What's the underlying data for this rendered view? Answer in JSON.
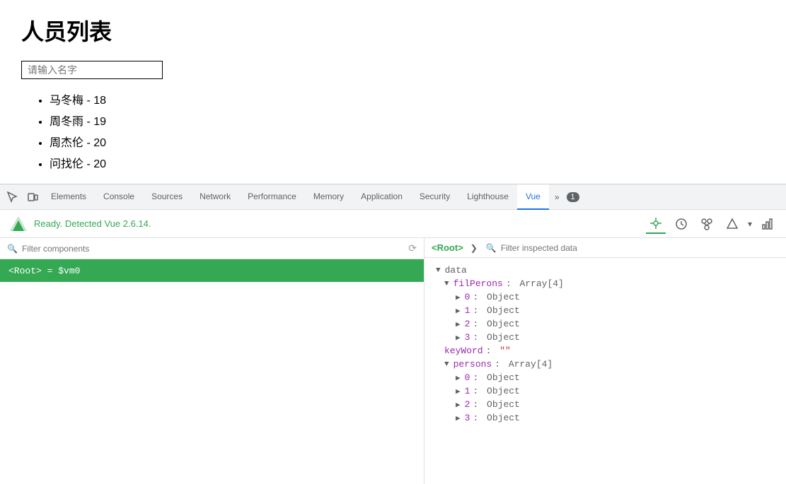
{
  "app": {
    "title": "人员列表",
    "search_placeholder": "请输入名字",
    "cursor_visible": true
  },
  "person_list": [
    {
      "name": "马冬梅",
      "age": 18
    },
    {
      "name": "周冬雨",
      "age": 19
    },
    {
      "name": "周杰伦",
      "age": 20
    },
    {
      "name": "问找伦",
      "age": 20
    }
  ],
  "devtools": {
    "tabs": [
      {
        "label": "Elements",
        "active": false
      },
      {
        "label": "Console",
        "active": false
      },
      {
        "label": "Sources",
        "active": false
      },
      {
        "label": "Network",
        "active": false
      },
      {
        "label": "Performance",
        "active": false
      },
      {
        "label": "Memory",
        "active": false
      },
      {
        "label": "Application",
        "active": false
      },
      {
        "label": "Security",
        "active": false
      },
      {
        "label": "Lighthouse",
        "active": false
      },
      {
        "label": "Vue",
        "active": true
      }
    ],
    "console_badge": "1",
    "vue_status": "Ready. Detected Vue 2.6.14.",
    "filter_components_placeholder": "Filter components",
    "filter_data_placeholder": "Filter inspected data",
    "root_component": "<Root> = $vm0",
    "root_label": "<Root>",
    "data_tree": {
      "data_label": "data",
      "nodes": [
        {
          "indent": 1,
          "expand": true,
          "key": "filPerons",
          "value": "Array[4]"
        },
        {
          "indent": 2,
          "expand": true,
          "key": "0",
          "value": "Object"
        },
        {
          "indent": 2,
          "expand": true,
          "key": "1",
          "value": "Object"
        },
        {
          "indent": 2,
          "expand": true,
          "key": "2",
          "value": "Object"
        },
        {
          "indent": 2,
          "expand": true,
          "key": "3",
          "value": "Object"
        },
        {
          "indent": 1,
          "expand": false,
          "key": "keyWord",
          "value": "\"\"",
          "is_string": true
        },
        {
          "indent": 1,
          "expand": true,
          "key": "persons",
          "value": "Array[4]"
        },
        {
          "indent": 2,
          "expand": true,
          "key": "0",
          "value": "Object"
        },
        {
          "indent": 2,
          "expand": true,
          "key": "1",
          "value": "Object"
        },
        {
          "indent": 2,
          "expand": true,
          "key": "2",
          "value": "Object"
        },
        {
          "indent": 2,
          "expand": true,
          "key": "3",
          "value": "Object"
        }
      ]
    }
  }
}
